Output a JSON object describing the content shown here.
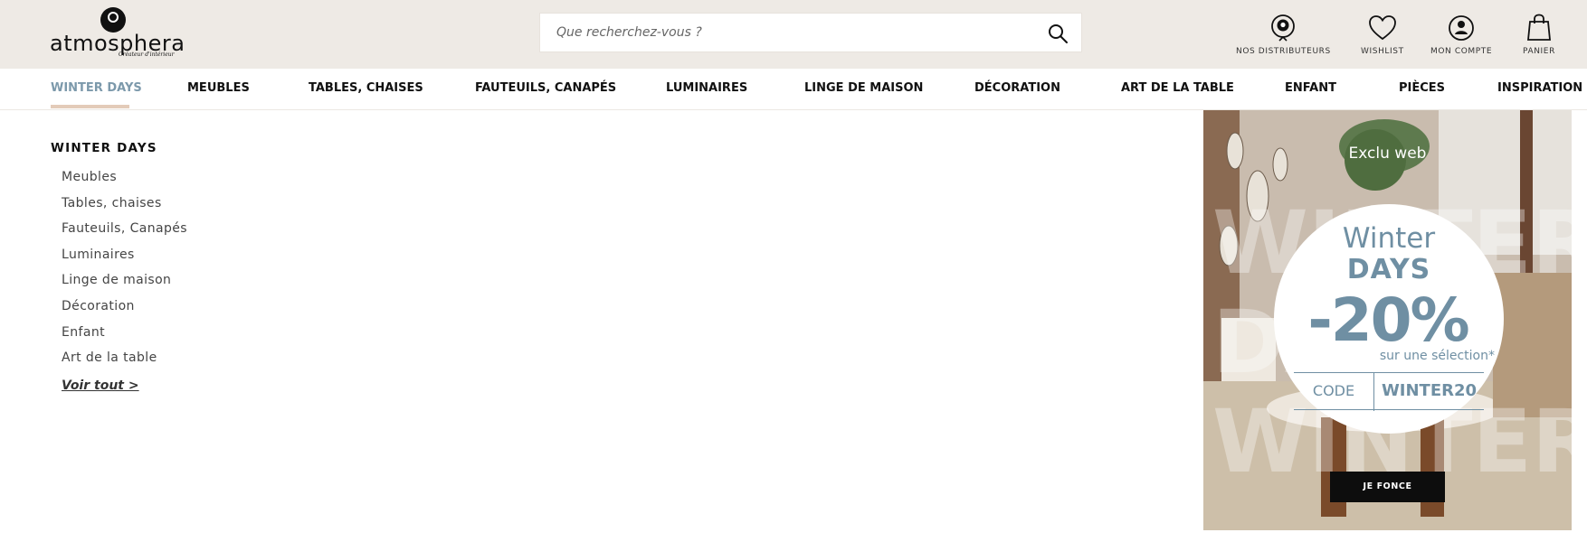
{
  "brand": {
    "name": "atmosphera",
    "tagline": "Créateur d'intérieur"
  },
  "search": {
    "placeholder": "Que recherchez-vous ?",
    "value": ""
  },
  "header_links": [
    {
      "label": "NOS DISTRIBUTEURS",
      "icon": "store-locator-icon"
    },
    {
      "label": "WISHLIST",
      "icon": "heart-icon"
    },
    {
      "label": "MON COMPTE",
      "icon": "user-icon"
    },
    {
      "label": "PANIER",
      "icon": "shopping-bag-icon"
    }
  ],
  "nav": {
    "items": [
      {
        "label": "WINTER DAYS",
        "active": true
      },
      {
        "label": "MEUBLES"
      },
      {
        "label": "TABLES, CHAISES"
      },
      {
        "label": "FAUTEUILS, CANAPÉS"
      },
      {
        "label": "LUMINAIRES"
      },
      {
        "label": "LINGE DE MAISON"
      },
      {
        "label": "DÉCORATION"
      },
      {
        "label": "ART DE LA TABLE"
      },
      {
        "label": "ENFANT"
      },
      {
        "label": "PIÈCES"
      },
      {
        "label": "INSPIRATION"
      }
    ],
    "active_color": "#7c99ab",
    "underline_color": "#e3cbb9"
  },
  "dropdown": {
    "title": "WINTER DAYS",
    "items": [
      "Meubles",
      "Tables, chaises",
      "Fauteuils, Canapés",
      "Luminaires",
      "Linge de maison",
      "Décoration",
      "Enfant",
      "Art de la table"
    ],
    "see_all": "Voir tout >"
  },
  "promo": {
    "badge": "Exclu web",
    "line1": "Winter",
    "line2": "DAYS",
    "discount": "-20%",
    "subtitle": "sur une sélection*",
    "code_label": "CODE",
    "code_value": "WINTER20",
    "cta": "JE FONCE",
    "accent_color": "#6f8fa3"
  },
  "colors": {
    "header_bg": "#eeeae5"
  }
}
